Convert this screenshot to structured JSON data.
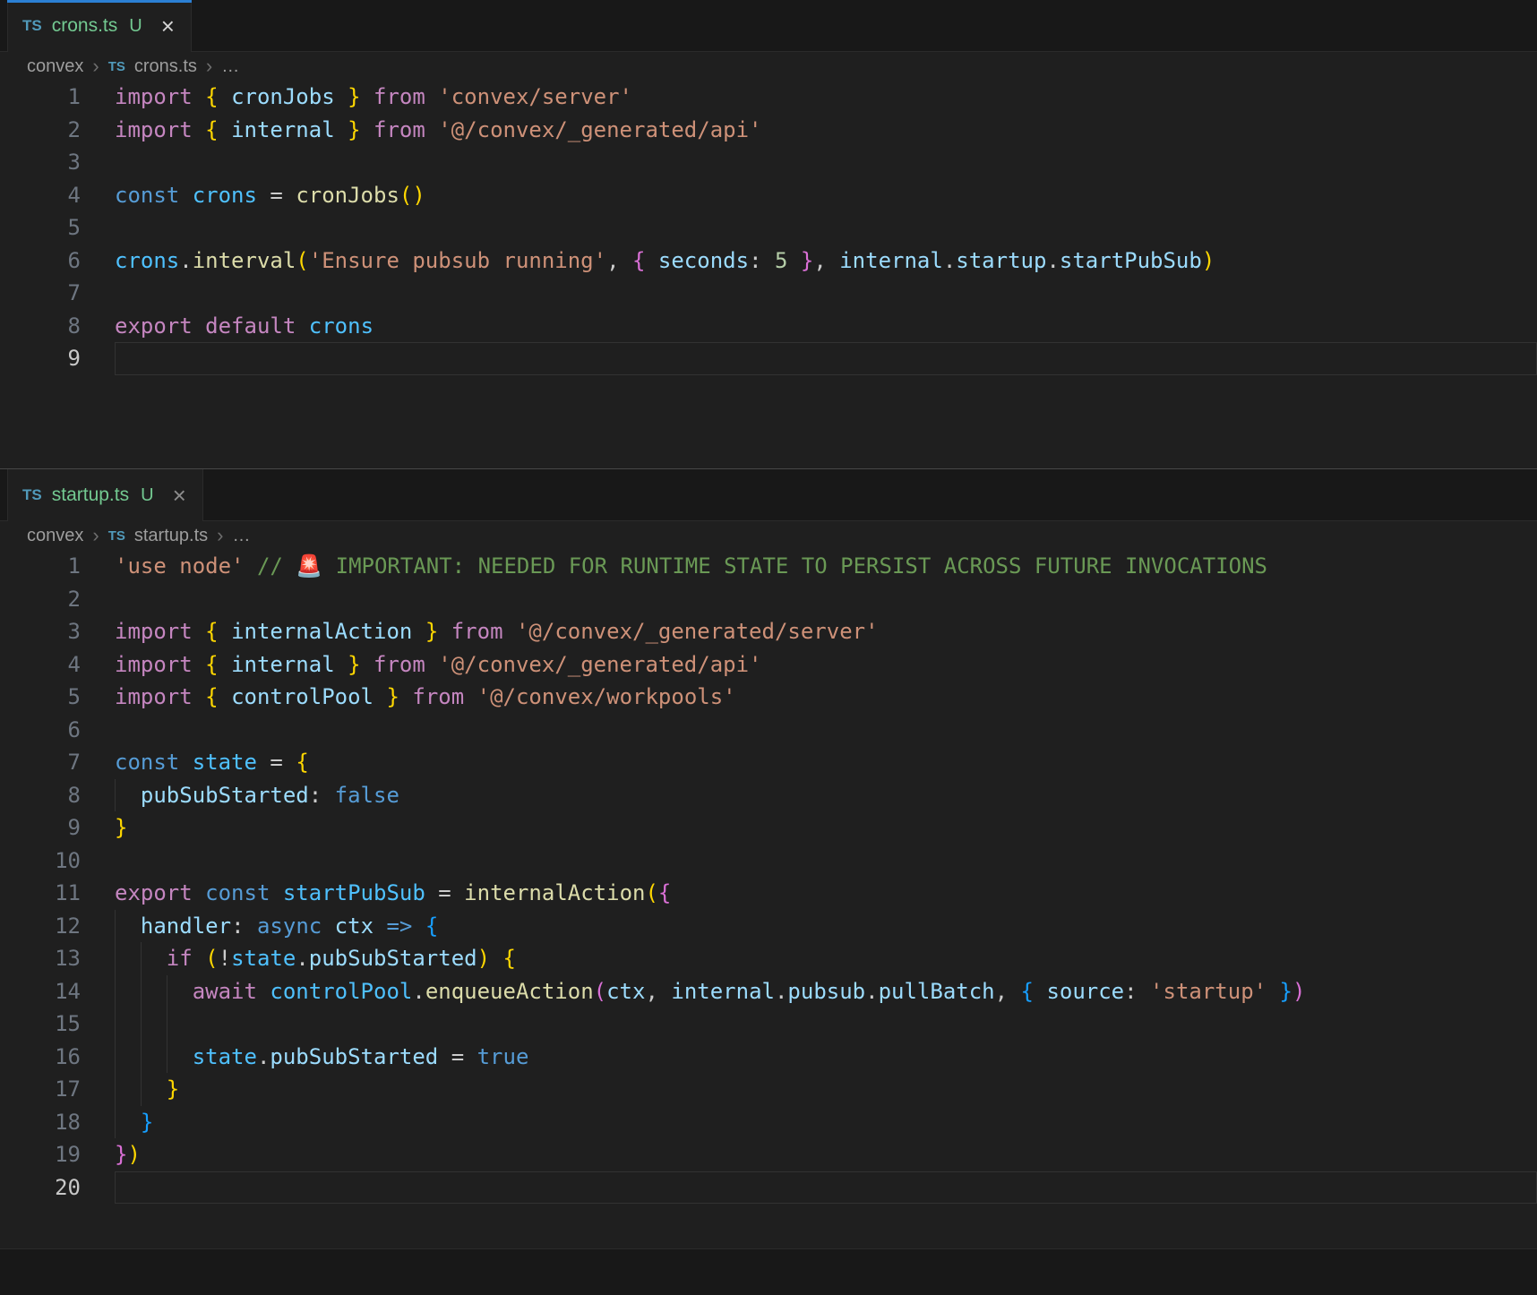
{
  "colors": {
    "editor_bg": "#1f1f1f",
    "tabbar_bg": "#181818",
    "border": "#2b2b2b",
    "separator": "#474747",
    "accent": "#2b7fd4",
    "green": "#73c991",
    "ts_icon": "#519aba",
    "close_active": "#d4d4d4",
    "close_inactive": "#8c8c8c",
    "breadcrumb": "#9d9d9d",
    "breadcrumb_sep": "#6e6e6e",
    "line_number": "#6e7681",
    "line_number_active": "#c8c8c8",
    "active_line_border": "#323232",
    "guide": "#333333",
    "kw": "#c586c0",
    "st": "#569cd6",
    "var": "#9cdcfe",
    "cv": "#4fc1ff",
    "fn": "#dcdcaa",
    "str": "#ce9178",
    "num": "#b5cea8",
    "cm": "#6a9955",
    "pl": "#cccccc",
    "b1": "#ffd700",
    "b2": "#da70d6",
    "b3": "#179fff"
  },
  "editors": [
    {
      "tab": {
        "icon": "TS",
        "name": "crons.ts",
        "badge": "U",
        "close_glyph": "×"
      },
      "breadcrumb": {
        "folder": "convex",
        "sep": "›",
        "icon": "TS",
        "file": "crons.ts",
        "more": "…"
      },
      "lines": [
        {
          "n": 1,
          "indent": 0,
          "guides": 0,
          "tokens": [
            [
              "kw",
              "import"
            ],
            [
              "pl",
              " "
            ],
            [
              "b1",
              "{"
            ],
            [
              "pl",
              " "
            ],
            [
              "var",
              "cronJobs"
            ],
            [
              "pl",
              " "
            ],
            [
              "b1",
              "}"
            ],
            [
              "pl",
              " "
            ],
            [
              "kw",
              "from"
            ],
            [
              "pl",
              " "
            ],
            [
              "str",
              "'convex/server'"
            ]
          ]
        },
        {
          "n": 2,
          "indent": 0,
          "guides": 0,
          "tokens": [
            [
              "kw",
              "import"
            ],
            [
              "pl",
              " "
            ],
            [
              "b1",
              "{"
            ],
            [
              "pl",
              " "
            ],
            [
              "var",
              "internal"
            ],
            [
              "pl",
              " "
            ],
            [
              "b1",
              "}"
            ],
            [
              "pl",
              " "
            ],
            [
              "kw",
              "from"
            ],
            [
              "pl",
              " "
            ],
            [
              "str",
              "'@/convex/_generated/api'"
            ]
          ]
        },
        {
          "n": 3,
          "indent": 0,
          "guides": 0,
          "tokens": []
        },
        {
          "n": 4,
          "indent": 0,
          "guides": 0,
          "tokens": [
            [
              "st",
              "const"
            ],
            [
              "pl",
              " "
            ],
            [
              "cv",
              "crons"
            ],
            [
              "pl",
              " = "
            ],
            [
              "fn",
              "cronJobs"
            ],
            [
              "b1",
              "()"
            ]
          ]
        },
        {
          "n": 5,
          "indent": 0,
          "guides": 0,
          "tokens": []
        },
        {
          "n": 6,
          "indent": 0,
          "guides": 0,
          "tokens": [
            [
              "cv",
              "crons"
            ],
            [
              "pl",
              "."
            ],
            [
              "fn",
              "interval"
            ],
            [
              "b1",
              "("
            ],
            [
              "str",
              "'Ensure pubsub running'"
            ],
            [
              "pl",
              ", "
            ],
            [
              "b2",
              "{"
            ],
            [
              "pl",
              " "
            ],
            [
              "var",
              "seconds"
            ],
            [
              "pl",
              ": "
            ],
            [
              "num",
              "5"
            ],
            [
              "pl",
              " "
            ],
            [
              "b2",
              "}"
            ],
            [
              "pl",
              ", "
            ],
            [
              "var",
              "internal"
            ],
            [
              "pl",
              "."
            ],
            [
              "var",
              "startup"
            ],
            [
              "pl",
              "."
            ],
            [
              "var",
              "startPubSub"
            ],
            [
              "b1",
              ")"
            ]
          ]
        },
        {
          "n": 7,
          "indent": 0,
          "guides": 0,
          "tokens": []
        },
        {
          "n": 8,
          "indent": 0,
          "guides": 0,
          "tokens": [
            [
              "kw",
              "export"
            ],
            [
              "pl",
              " "
            ],
            [
              "kw",
              "default"
            ],
            [
              "pl",
              " "
            ],
            [
              "cv",
              "crons"
            ]
          ]
        },
        {
          "n": 9,
          "indent": 0,
          "guides": 0,
          "active": true,
          "tokens": []
        }
      ]
    },
    {
      "tab": {
        "icon": "TS",
        "name": "startup.ts",
        "badge": "U",
        "close_glyph": "×"
      },
      "breadcrumb": {
        "folder": "convex",
        "sep": "›",
        "icon": "TS",
        "file": "startup.ts",
        "more": "…"
      },
      "lines": [
        {
          "n": 1,
          "indent": 0,
          "guides": 0,
          "tokens": [
            [
              "str",
              "'use node'"
            ],
            [
              "pl",
              " "
            ],
            [
              "cm",
              "// 🚨 IMPORTANT: NEEDED FOR RUNTIME STATE TO PERSIST ACROSS FUTURE INVOCATIONS"
            ]
          ]
        },
        {
          "n": 2,
          "indent": 0,
          "guides": 0,
          "tokens": []
        },
        {
          "n": 3,
          "indent": 0,
          "guides": 0,
          "tokens": [
            [
              "kw",
              "import"
            ],
            [
              "pl",
              " "
            ],
            [
              "b1",
              "{"
            ],
            [
              "pl",
              " "
            ],
            [
              "var",
              "internalAction"
            ],
            [
              "pl",
              " "
            ],
            [
              "b1",
              "}"
            ],
            [
              "pl",
              " "
            ],
            [
              "kw",
              "from"
            ],
            [
              "pl",
              " "
            ],
            [
              "str",
              "'@/convex/_generated/server'"
            ]
          ]
        },
        {
          "n": 4,
          "indent": 0,
          "guides": 0,
          "tokens": [
            [
              "kw",
              "import"
            ],
            [
              "pl",
              " "
            ],
            [
              "b1",
              "{"
            ],
            [
              "pl",
              " "
            ],
            [
              "var",
              "internal"
            ],
            [
              "pl",
              " "
            ],
            [
              "b1",
              "}"
            ],
            [
              "pl",
              " "
            ],
            [
              "kw",
              "from"
            ],
            [
              "pl",
              " "
            ],
            [
              "str",
              "'@/convex/_generated/api'"
            ]
          ]
        },
        {
          "n": 5,
          "indent": 0,
          "guides": 0,
          "tokens": [
            [
              "kw",
              "import"
            ],
            [
              "pl",
              " "
            ],
            [
              "b1",
              "{"
            ],
            [
              "pl",
              " "
            ],
            [
              "var",
              "controlPool"
            ],
            [
              "pl",
              " "
            ],
            [
              "b1",
              "}"
            ],
            [
              "pl",
              " "
            ],
            [
              "kw",
              "from"
            ],
            [
              "pl",
              " "
            ],
            [
              "str",
              "'@/convex/workpools'"
            ]
          ]
        },
        {
          "n": 6,
          "indent": 0,
          "guides": 0,
          "tokens": []
        },
        {
          "n": 7,
          "indent": 0,
          "guides": 0,
          "tokens": [
            [
              "st",
              "const"
            ],
            [
              "pl",
              " "
            ],
            [
              "cv",
              "state"
            ],
            [
              "pl",
              " = "
            ],
            [
              "b1",
              "{"
            ]
          ]
        },
        {
          "n": 8,
          "indent": 2,
          "guides": 1,
          "tokens": [
            [
              "var",
              "pubSubStarted"
            ],
            [
              "pl",
              ": "
            ],
            [
              "st",
              "false"
            ]
          ]
        },
        {
          "n": 9,
          "indent": 0,
          "guides": 0,
          "tokens": [
            [
              "b1",
              "}"
            ]
          ]
        },
        {
          "n": 10,
          "indent": 0,
          "guides": 0,
          "tokens": []
        },
        {
          "n": 11,
          "indent": 0,
          "guides": 0,
          "tokens": [
            [
              "kw",
              "export"
            ],
            [
              "pl",
              " "
            ],
            [
              "st",
              "const"
            ],
            [
              "pl",
              " "
            ],
            [
              "cv",
              "startPubSub"
            ],
            [
              "pl",
              " = "
            ],
            [
              "fn",
              "internalAction"
            ],
            [
              "b1",
              "("
            ],
            [
              "b2",
              "{"
            ]
          ]
        },
        {
          "n": 12,
          "indent": 2,
          "guides": 1,
          "tokens": [
            [
              "var",
              "handler"
            ],
            [
              "pl",
              ": "
            ],
            [
              "st",
              "async"
            ],
            [
              "pl",
              " "
            ],
            [
              "var",
              "ctx"
            ],
            [
              "pl",
              " "
            ],
            [
              "st",
              "=>"
            ],
            [
              "pl",
              " "
            ],
            [
              "b3",
              "{"
            ]
          ]
        },
        {
          "n": 13,
          "indent": 4,
          "guides": 2,
          "tokens": [
            [
              "kw",
              "if"
            ],
            [
              "pl",
              " "
            ],
            [
              "b1",
              "("
            ],
            [
              "pl",
              "!"
            ],
            [
              "cv",
              "state"
            ],
            [
              "pl",
              "."
            ],
            [
              "var",
              "pubSubStarted"
            ],
            [
              "b1",
              ")"
            ],
            [
              "pl",
              " "
            ],
            [
              "b1",
              "{"
            ]
          ]
        },
        {
          "n": 14,
          "indent": 6,
          "guides": 3,
          "tokens": [
            [
              "kw",
              "await"
            ],
            [
              "pl",
              " "
            ],
            [
              "cv",
              "controlPool"
            ],
            [
              "pl",
              "."
            ],
            [
              "fn",
              "enqueueAction"
            ],
            [
              "b2",
              "("
            ],
            [
              "var",
              "ctx"
            ],
            [
              "pl",
              ", "
            ],
            [
              "var",
              "internal"
            ],
            [
              "pl",
              "."
            ],
            [
              "var",
              "pubsub"
            ],
            [
              "pl",
              "."
            ],
            [
              "var",
              "pullBatch"
            ],
            [
              "pl",
              ", "
            ],
            [
              "b3",
              "{"
            ],
            [
              "pl",
              " "
            ],
            [
              "var",
              "source"
            ],
            [
              "pl",
              ": "
            ],
            [
              "str",
              "'startup'"
            ],
            [
              "pl",
              " "
            ],
            [
              "b3",
              "}"
            ],
            [
              "b2",
              ")"
            ]
          ]
        },
        {
          "n": 15,
          "indent": 0,
          "guides": 3,
          "tokens": []
        },
        {
          "n": 16,
          "indent": 6,
          "guides": 3,
          "tokens": [
            [
              "cv",
              "state"
            ],
            [
              "pl",
              "."
            ],
            [
              "var",
              "pubSubStarted"
            ],
            [
              "pl",
              " = "
            ],
            [
              "st",
              "true"
            ]
          ]
        },
        {
          "n": 17,
          "indent": 4,
          "guides": 2,
          "tokens": [
            [
              "b1",
              "}"
            ]
          ]
        },
        {
          "n": 18,
          "indent": 2,
          "guides": 1,
          "tokens": [
            [
              "b3",
              "}"
            ]
          ]
        },
        {
          "n": 19,
          "indent": 0,
          "guides": 0,
          "tokens": [
            [
              "b2",
              "}"
            ],
            [
              "b1",
              ")"
            ]
          ]
        },
        {
          "n": 20,
          "indent": 0,
          "guides": 0,
          "active": true,
          "tokens": []
        }
      ]
    }
  ]
}
